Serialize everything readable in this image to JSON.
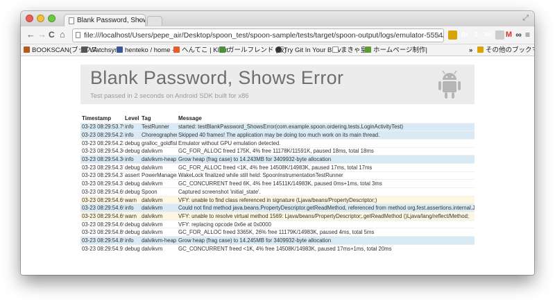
{
  "browser": {
    "tab_title": "Blank Password, Shows Er",
    "tab_close": "×",
    "url": "file:///localhost/Users/pepe_air/Desktop/spoon_test/spoon-sample/tests/target/spoon-output/logs/emulator-5554/com.example.spoon.o...",
    "nav": {
      "back": "←",
      "forward": "→",
      "reload": "C",
      "home": "⌂"
    },
    "extensions": [
      {
        "name": "B!",
        "color": "#2f72d1"
      },
      {
        "name": "2",
        "color": "#3a6fb6"
      },
      {
        "name": "300",
        "color": "#c8102e"
      },
      {
        "name": "M",
        "color": "#d93025"
      },
      {
        "name": "∞",
        "color": "#333333"
      },
      {
        "name": "≡",
        "color": "#555555"
      }
    ]
  },
  "bookmarks": {
    "items": [
      {
        "label": "BOOKSCAN(ブックス",
        "color": "#b55a1b"
      },
      {
        "label": "Watchsync",
        "color": "#555555"
      },
      {
        "label": "henteko / home --",
        "color": "#3b5998"
      },
      {
        "label": "へんてこ | Klout",
        "color": "#e65c2b"
      },
      {
        "label": "ガールフレンド (仮)",
        "color": "#4a8f3c"
      },
      {
        "label": "Try Git In Your Brov",
        "color": "#333333"
      },
      {
        "label": "まきゃ皇",
        "color": "#888888"
      },
      {
        "label": "ホームページ制作|",
        "color": "#5b9e2f"
      }
    ],
    "more": "»",
    "other": "その他のブックマーク"
  },
  "page": {
    "title": "Blank Password, Shows Error",
    "subtitle": "Test passed in 2 seconds on Android SDK built for x86",
    "columns": {
      "timestamp": "Timestamp",
      "level": "Level",
      "tag": "Tag",
      "message": "Message"
    },
    "rows": [
      {
        "ts": "03-23 08:29:53.798",
        "level": "info",
        "tag": "TestRunner",
        "msg": "started: testBlankPassword_ShowsError(com.example.spoon.ordering.tests.LoginActivityTest)"
      },
      {
        "ts": "03-23 08:29:54.238",
        "level": "info",
        "tag": "Choreographer",
        "msg": "Skipped 40 frames! The application may be doing too much work on its main thread."
      },
      {
        "ts": "03-23 08:29:54.238",
        "level": "debug",
        "tag": "gralloc_goldfish",
        "msg": "Emulator without GPU emulation detected."
      },
      {
        "ts": "03-23 08:29:54.360",
        "level": "debug",
        "tag": "dalvikvm",
        "msg": "GC_FOR_ALLOC freed 175K, 4% free 11178K/11591K, paused 18ms, total 18ms"
      },
      {
        "ts": "03-23 08:29:54.360",
        "level": "info",
        "tag": "dalvikvm-heap",
        "msg": "Grow heap (frag case) to 14.243MB for 3409932-byte allocation"
      },
      {
        "ts": "03-23 08:29:54.379",
        "level": "debug",
        "tag": "dalvikvm",
        "msg": "GC_FOR_ALLOC freed <1K, 4% free 14508K/14983K, paused 17ms, total 17ms"
      },
      {
        "ts": "03-23 08:29:54.379",
        "level": "assert",
        "tag": "PowerManager",
        "msg": "WakeLock finalized while still held: SpoonInstrumentationTestRunner"
      },
      {
        "ts": "03-23 08:29:54.379",
        "level": "debug",
        "tag": "dalvikvm",
        "msg": "GC_CONCURRENT freed 6K, 4% free 14511K/14983K, paused 0ms+1ms, total 3ms"
      },
      {
        "ts": "03-23 08:29:54.699",
        "level": "debug",
        "tag": "Spoon",
        "msg": "Captured screenshot 'initial_state'."
      },
      {
        "ts": "03-23 08:29:54.699",
        "level": "warn",
        "tag": "dalvikvm",
        "msg": "VFY: unable to find class referenced in signature (Ljava/beans/PropertyDescriptor;)"
      },
      {
        "ts": "03-23 08:29:54.699",
        "level": "info",
        "tag": "dalvikvm",
        "msg": "Could not find method java.beans.PropertyDescriptor.getReadMethod, referenced from method org.fest.assertions.internal.JavaBeanDescript"
      },
      {
        "ts": "03-23 08:29:54.699",
        "level": "warn",
        "tag": "dalvikvm",
        "msg": "VFY: unable to resolve virtual method 1569: Ljava/beans/PropertyDescriptor;.getReadMethod ()Ljava/lang/reflect/Method;"
      },
      {
        "ts": "03-23 08:29:54.699",
        "level": "debug",
        "tag": "dalvikvm",
        "msg": "VFY: replacing opcode 0x6e at 0x0000"
      },
      {
        "ts": "03-23 08:29:54.898",
        "level": "debug",
        "tag": "dalvikvm",
        "msg": "GC_FOR_ALLOC freed 3365K, 26% free 11179K/14983K, paused 4ms, total 5ms"
      },
      {
        "ts": "03-23 08:29:54.898",
        "level": "info",
        "tag": "dalvikvm-heap",
        "msg": "Grow heap (frag case) to 14.245MB for 3409932-byte allocation"
      },
      {
        "ts": "03-23 08:29:54.918",
        "level": "debug",
        "tag": "dalvikvm",
        "msg": "GC_CONCURRENT freed <1K, 4% free 14508K/14983K, paused 17ms+1ms, total 20ms"
      }
    ]
  }
}
